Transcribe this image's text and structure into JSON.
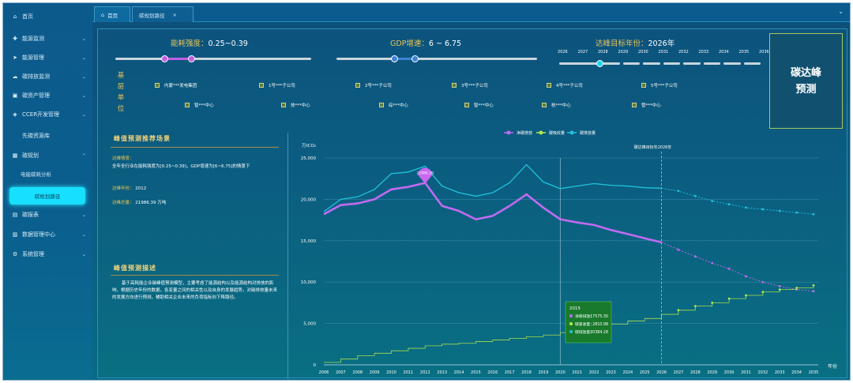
{
  "sidebar": {
    "items": [
      {
        "icon": "home-icon",
        "glyph": "⌂",
        "label": "首页",
        "chev": ""
      },
      {
        "icon": "monitor-icon",
        "glyph": "✚",
        "label": "能源监测",
        "chev": "⌄"
      },
      {
        "icon": "send-icon",
        "glyph": "➤",
        "label": "能源管理",
        "chev": "⌄"
      },
      {
        "icon": "cloud-icon",
        "glyph": "☁",
        "label": "碳排放监测",
        "chev": "⌄"
      },
      {
        "icon": "asset-icon",
        "glyph": "▣",
        "label": "碳资产管理",
        "chev": "⌄"
      },
      {
        "icon": "shield-icon",
        "glyph": "◈",
        "label": "CCER开发管理",
        "chev": "⌄"
      },
      {
        "icon": "tag-icon",
        "glyph": "",
        "label": "先碳资源库",
        "chev": ""
      },
      {
        "icon": "plan-icon",
        "glyph": "▦",
        "label": "碳规划",
        "chev": "⌃"
      },
      {
        "icon": "report-icon",
        "glyph": "▤",
        "label": "碳报表",
        "chev": "⌄"
      },
      {
        "icon": "data-icon",
        "glyph": "▥",
        "label": "数据管理中心",
        "chev": "⌄"
      },
      {
        "icon": "gear-icon",
        "glyph": "⚙",
        "label": "系统管理",
        "chev": "⌄"
      }
    ],
    "sub_item": "电能碳耗分析",
    "active_item": "碳规划路径"
  },
  "tabs": {
    "home": "首页",
    "active": "碳规划路径",
    "close": "×",
    "collapse": "⌄"
  },
  "sliders": {
    "energy": {
      "label": "能耗强度：",
      "value": "0.25~0.39",
      "range_frac": [
        0.25,
        0.39
      ]
    },
    "gdp": {
      "label": "GDP增速：",
      "value": "6 ~ 6.75",
      "range_frac": [
        0.29,
        0.39
      ]
    },
    "peak_year": {
      "label": "达峰目标年份：",
      "value": "2026年",
      "years": [
        "2026",
        "2027",
        "2028",
        "2029",
        "2030",
        "2031",
        "2032",
        "2033",
        "2034",
        "2035",
        "2036"
      ],
      "selected_index": 2
    }
  },
  "units": {
    "title": "基层单位",
    "row1": [
      "内蒙***发电集团",
      "1号***子公司",
      "2号***子公司",
      "3号***子公司",
      "4号***子公司",
      "5号***子公司"
    ],
    "row2": [
      "智***中心",
      "技***中心",
      "综***中心",
      "智***中心",
      "核***中心",
      "管***中心"
    ]
  },
  "predict_button": [
    "碳达峰",
    "预测"
  ],
  "scenario": {
    "title": "峰值预测推荐场景",
    "scene_label": "达峰情景：",
    "scene_text": "全年全行业在能耗强度为[0.25~0.39]，GDP增速为[6~6.75]的情景下",
    "year_label": "达峰年份：",
    "year_value": "2012",
    "total_label": "达峰总量：",
    "total_value": "21986.39 万吨"
  },
  "description": {
    "title": "峰值预测描述",
    "text": "基于高耗能企业碳峰值预测模型，主要考虑了能源结构以及能源结构对排放的影响，根据历史年份的数据，各变量之间的相关性以及自身的发展趋势，对碳排放量未来的发展方向进行预测，辅助相关企业未来的负荷指标向下降路径。"
  },
  "chart_data": {
    "type": "line",
    "unit_label": "万tCO₂",
    "xlabel": "年份",
    "x": [
      "2006",
      "2007",
      "2008",
      "2009",
      "2010",
      "2011",
      "2012",
      "2013",
      "2014",
      "2015",
      "2016",
      "2017",
      "2018",
      "2019",
      "2020",
      "2021",
      "2022",
      "2023",
      "2024",
      "2025",
      "2026",
      "2027",
      "2028",
      "2029",
      "2030",
      "2031",
      "2032",
      "2033",
      "2034",
      "2035"
    ],
    "ylim": [
      0,
      25000
    ],
    "yticks": [
      0,
      5000,
      10000,
      15000,
      20000,
      25000
    ],
    "ytick_labels": [
      "0",
      "5,000",
      "10,000",
      "15,000",
      "20,000",
      "25,000"
    ],
    "series": [
      {
        "name": "净碳排放",
        "color": "#c06bf0",
        "values": [
          18200,
          19300,
          19500,
          20000,
          21200,
          21500,
          21986,
          19200,
          18600,
          17575,
          18000,
          19200,
          20600,
          19000,
          17600,
          17200,
          16900,
          16300,
          15800,
          15300,
          14800,
          13900,
          13100,
          12300,
          11600,
          10700,
          10000,
          9500,
          9100,
          8900
        ]
      },
      {
        "name": "碳吸收量",
        "color": "#b8e84a",
        "values": [
          300,
          700,
          1100,
          1400,
          1700,
          2000,
          2300,
          2500,
          2600,
          2810,
          3000,
          3200,
          3400,
          3600,
          3900,
          4200,
          4600,
          4900,
          5300,
          5600,
          6100,
          6600,
          7100,
          7500,
          8000,
          8400,
          8800,
          9100,
          9300,
          9600
        ]
      },
      {
        "name": "碳排放量",
        "color": "#21c3e0",
        "values": [
          18500,
          20000,
          20300,
          21200,
          23100,
          23300,
          24000,
          21600,
          20800,
          20384,
          20800,
          22000,
          24200,
          22100,
          21300,
          21600,
          21900,
          21700,
          21600,
          21400,
          21350,
          21000,
          20400,
          19800,
          19400,
          19000,
          18800,
          18600,
          18400,
          18200
        ]
      }
    ],
    "peak_marker": {
      "x": "2012",
      "label": "21986.39"
    },
    "target_line": {
      "x": "2026",
      "label": "碳达峰目标年2026年"
    },
    "reference_line": {
      "x": "2020"
    },
    "tooltip": {
      "year": "2015",
      "rows": [
        {
          "label": "净碳排放：",
          "value": "17575.30"
        },
        {
          "label": "碳吸收量：",
          "value": "2810.98"
        },
        {
          "label": "碳排放量：",
          "value": "20384.28"
        }
      ]
    }
  }
}
